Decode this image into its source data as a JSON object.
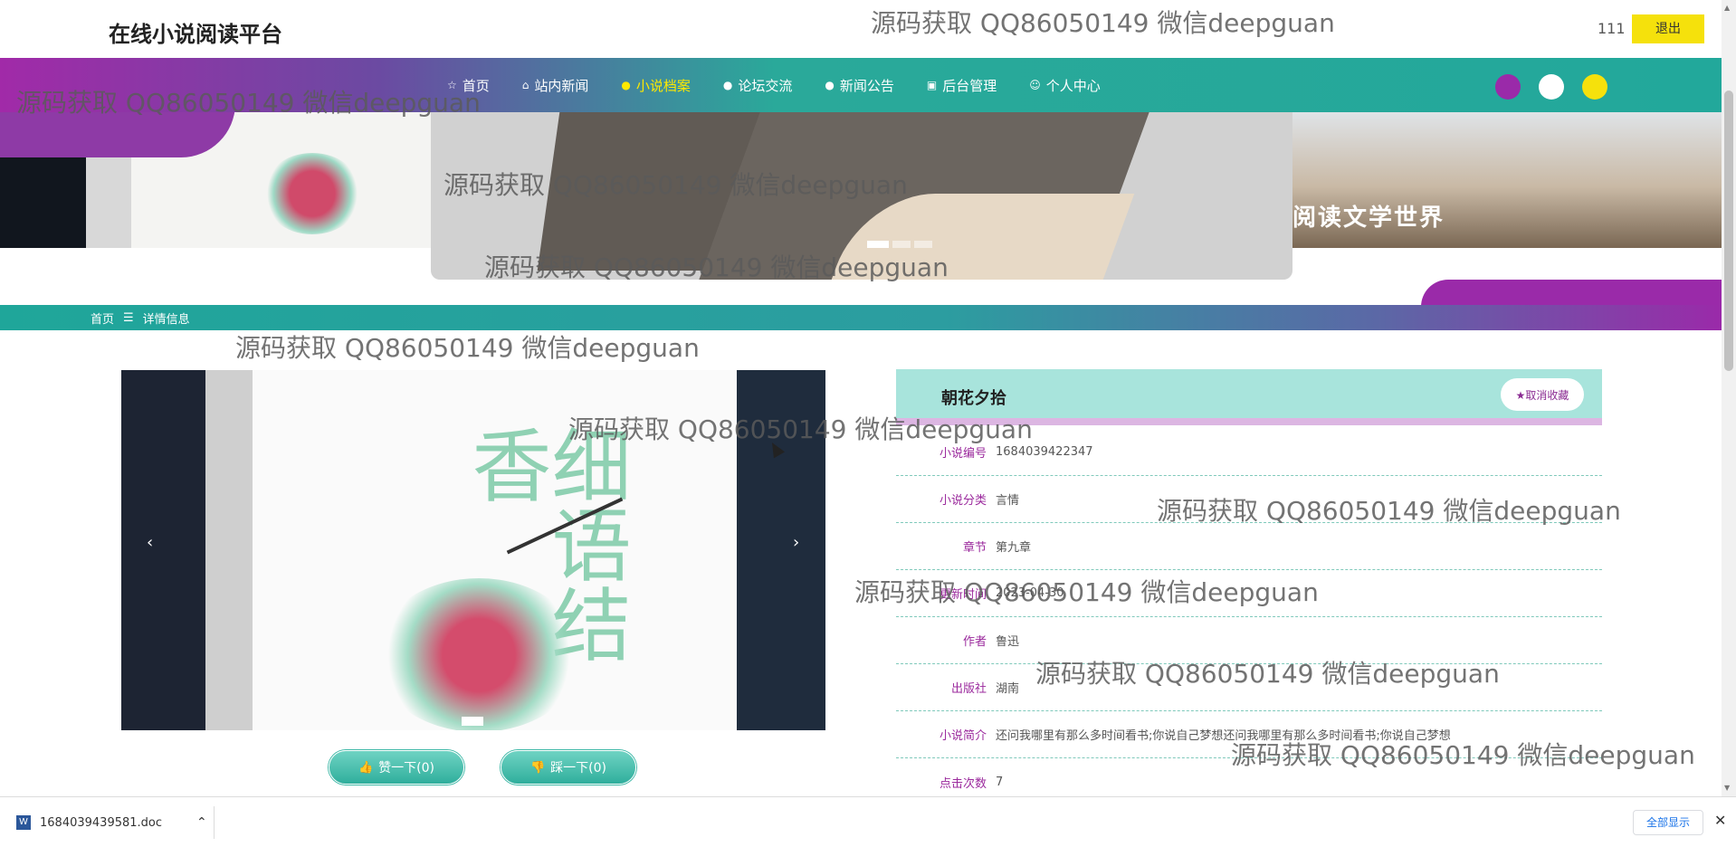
{
  "header": {
    "site_title": "在线小说阅读平台",
    "user_name": "111",
    "logout_label": "退出"
  },
  "nav": {
    "items": [
      {
        "label": "首页",
        "icon": "home-icon"
      },
      {
        "label": "站内新闻",
        "icon": "bag-icon"
      },
      {
        "label": "小说档案",
        "icon": "info-icon",
        "active": true
      },
      {
        "label": "论坛交流",
        "icon": "question-icon"
      },
      {
        "label": "新闻公告",
        "icon": "info-icon"
      },
      {
        "label": "后台管理",
        "icon": "clipboard-icon"
      },
      {
        "label": "个人中心",
        "icon": "user-icon"
      }
    ],
    "theme_colors": [
      "#9a2aa9",
      "#ffffff",
      "#f5e10c"
    ]
  },
  "banner": {
    "right_text": "阅读文学世界"
  },
  "breadcrumb": {
    "home": "首页",
    "separator": "☰",
    "current": "详情信息"
  },
  "detail": {
    "title": "朝花夕拾",
    "unfavorite_label": "★取消收藏",
    "like_label": "赞一下(0)",
    "dislike_label": "踩一下(0)",
    "fields": [
      {
        "label": "小说编号",
        "value": "1684039422347"
      },
      {
        "label": "小说分类",
        "value": "言情"
      },
      {
        "label": "章节",
        "value": "第九章"
      },
      {
        "label": "更新时间",
        "value": "2023-04-30"
      },
      {
        "label": "作者",
        "value": "鲁迅"
      },
      {
        "label": "出版社",
        "value": "湖南"
      },
      {
        "label": "小说简介",
        "value": "还问我哪里有那么多时间看书;你说自己梦想还问我哪里有那么多时间看书;你说自己梦想"
      },
      {
        "label": "点击次数",
        "value": "7"
      }
    ],
    "cover_text": "细语结香"
  },
  "download": {
    "file_name": "1684039439581.doc",
    "show_all": "全部显示"
  },
  "watermark": "源码获取 QQ86050149 微信deepguan"
}
